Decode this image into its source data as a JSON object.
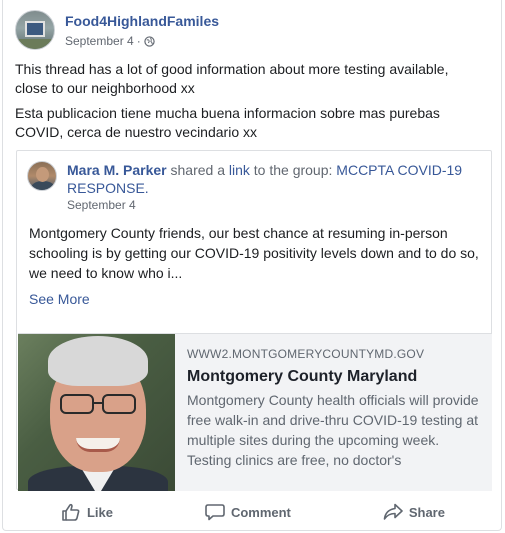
{
  "post": {
    "page_name": "Food4HighlandFamiles",
    "date": "September 4",
    "separator": "·",
    "privacy_icon": "globe-icon",
    "text_en": "This thread has a lot of good information about more testing available, close to our neighborhood xx",
    "text_es": "Esta publicacion tiene mucha buena informacion sobre mas purebas COVID, cerca de nuestro vecindario xx"
  },
  "shared": {
    "author": "Mara M. Parker",
    "verb": "shared a",
    "link_word": "link",
    "to_group": "to the group:",
    "group_name": "MCCPTA COVID-19 RESPONSE.",
    "date": "September 4",
    "body": "Montgomery County friends, our best chance at resuming in-person schooling is by getting our COVID-19 positivity levels down and to do so, we need to know who i...",
    "see_more": "See More"
  },
  "link_card": {
    "domain": "WWW2.MONTGOMERYCOUNTYMD.GOV",
    "title": "Montgomery County Maryland",
    "description": "Montgomery County health officials will provide free walk-in and drive-thru COVID-19 testing at multiple sites during the upcoming week. Testing clinics are free, no doctor's"
  },
  "actions": {
    "like": "Like",
    "comment": "Comment",
    "share": "Share"
  },
  "colors": {
    "link_blue": "#385898",
    "meta_gray": "#616770",
    "card_bg": "#f2f3f5",
    "border": "#dddfe2"
  }
}
